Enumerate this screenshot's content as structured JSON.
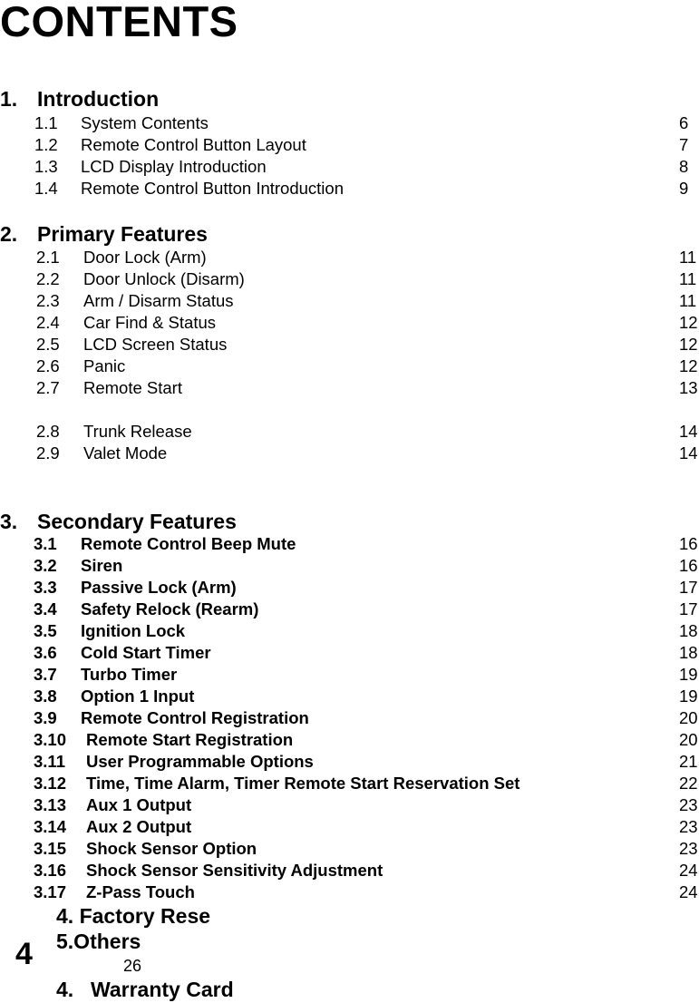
{
  "title": "CONTENTS",
  "sections": [
    {
      "number": "1.",
      "heading": "Introduction",
      "items": [
        {
          "num": "1.1",
          "label": "System Contents",
          "page": "6"
        },
        {
          "num": "1.2",
          "label": "Remote Control Button Layout",
          "page": "7"
        },
        {
          "num": "1.3",
          "label": "LCD Display Introduction",
          "page": "8"
        },
        {
          "num": "1.4",
          "label": "Remote Control Button Introduction",
          "page": "9"
        }
      ]
    },
    {
      "number": "2.",
      "heading": "Primary Features",
      "items": [
        {
          "num": "2.1",
          "label": "Door Lock (Arm)",
          "page": "11"
        },
        {
          "num": "2.2",
          "label": "Door Unlock (Disarm)",
          "page": "11"
        },
        {
          "num": "2.3",
          "label": "Arm / Disarm Status",
          "page": "11"
        },
        {
          "num": "2.4",
          "label": "Car Find & Status",
          "page": "12"
        },
        {
          "num": "2.5",
          "label": "LCD Screen Status",
          "page": "12"
        },
        {
          "num": "2.6",
          "label": "Panic",
          "page": "12"
        },
        {
          "num": "2.7",
          "label": "Remote Start",
          "page": "13"
        },
        {
          "num": "2.8",
          "label": "Trunk Release",
          "page": "14"
        },
        {
          "num": "2.9",
          "label": "Valet Mode",
          "page": "14"
        }
      ]
    },
    {
      "number": "3.",
      "heading": "Secondary Features",
      "items": [
        {
          "num": "3.1",
          "label": "Remote Control Beep Mute",
          "page": "16"
        },
        {
          "num": "3.2",
          "label": "Siren",
          "page": "16"
        },
        {
          "num": "3.3",
          "label": "Passive Lock (Arm)",
          "page": "17"
        },
        {
          "num": "3.4",
          "label": "Safety Relock (Rearm)",
          "page": "17"
        },
        {
          "num": "3.5",
          "label": "Ignition Lock",
          "page": "18"
        },
        {
          "num": "3.6",
          "label": "Cold Start Timer",
          "page": "18"
        },
        {
          "num": "3.7",
          "label": "Turbo Timer",
          "page": "19"
        },
        {
          "num": "3.8",
          "label": "Option 1 Input",
          "page": "19"
        },
        {
          "num": "3.9",
          "label": "Remote Control Registration",
          "page": "20"
        },
        {
          "num": "3.10",
          "label": "Remote Start Registration",
          "page": "20"
        },
        {
          "num": "3.11",
          "label": "User Programmable Options",
          "page": "21"
        },
        {
          "num": "3.12",
          "label": "Time, Time Alarm, Timer Remote Start Reservation Set",
          "page": "22"
        },
        {
          "num": "3.13",
          "label": "Aux 1 Output",
          "page": "23"
        },
        {
          "num": "3.14",
          "label": "Aux 2 Output",
          "page": "23"
        },
        {
          "num": "3.15",
          "label": "Shock Sensor Option",
          "page": "23"
        },
        {
          "num": "3.16",
          "label": "Shock Sensor Sensitivity Adjustment",
          "page": "24"
        },
        {
          "num": "3.17",
          "label": "Z-Pass Touch",
          "page": "24"
        }
      ]
    }
  ],
  "tail": {
    "factory_reset": "4. Factory Rese",
    "others": "5.Others",
    "others_page": "26",
    "warranty_num": "4.",
    "warranty_label": "Warranty Card"
  },
  "page_number": "4"
}
